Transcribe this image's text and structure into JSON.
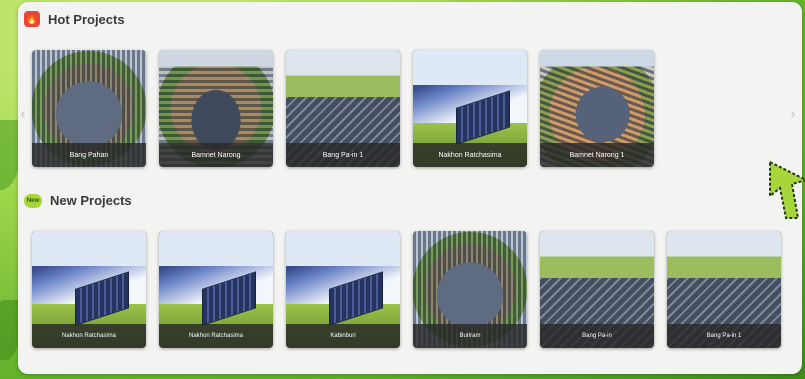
{
  "colors": {
    "hot_icon": "#e8453c",
    "new_icon": "#a8d63a",
    "caption_bg": "#282828"
  },
  "hot": {
    "title": "Hot Projects",
    "icon": "flame-icon",
    "cards": [
      {
        "label": "Bang Pahan",
        "style": "aerial"
      },
      {
        "label": "Bamnet Narong",
        "style": "aerial2"
      },
      {
        "label": "Bang Pa-in 1",
        "style": "aerial3"
      },
      {
        "label": "Nakhon Ratchasima",
        "style": "tracker"
      },
      {
        "label": "Bamnet Narong 1",
        "style": "sandfield"
      }
    ]
  },
  "new": {
    "title": "New Projects",
    "icon_text": "New",
    "cards": [
      {
        "label": "Nakhon Ratchasima",
        "style": "tracker"
      },
      {
        "label": "Nakhon Ratchasima",
        "style": "tracker"
      },
      {
        "label": "Kabinburi",
        "style": "tracker"
      },
      {
        "label": "Buriram",
        "style": "aerial"
      },
      {
        "label": "Bang Pa-in",
        "style": "aerial3"
      },
      {
        "label": "Bang Pa-in 1",
        "style": "aerial3"
      }
    ]
  },
  "nav": {
    "prev": "‹",
    "next": "›"
  }
}
